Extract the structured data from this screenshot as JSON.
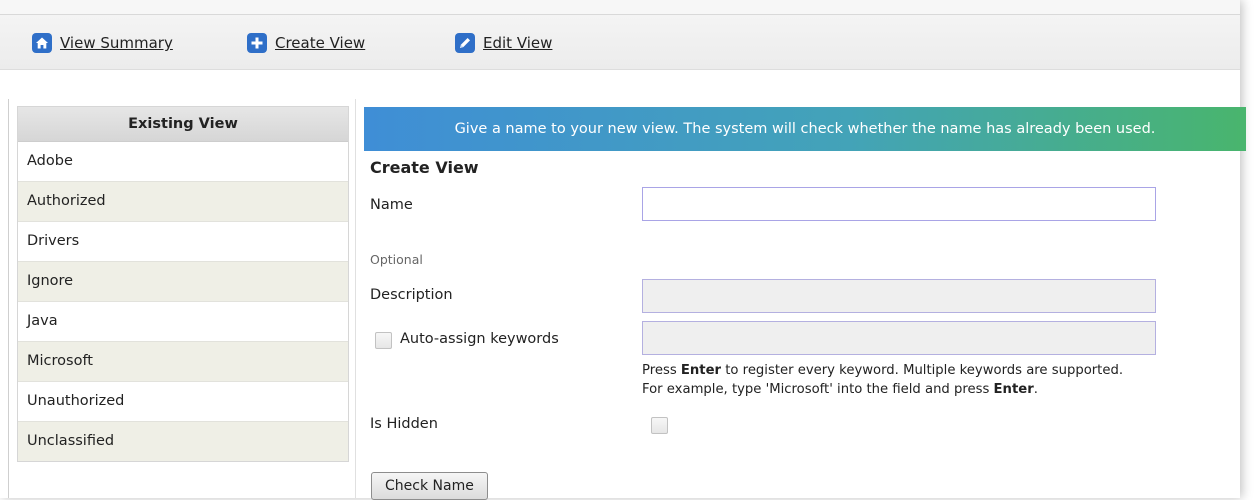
{
  "toolbar": {
    "items": [
      {
        "label": "View Summary",
        "icon": "home-icon"
      },
      {
        "label": "Create View",
        "icon": "plus-icon"
      },
      {
        "label": "Edit View",
        "icon": "pencil-icon"
      }
    ]
  },
  "existing_view": {
    "header": "Existing View",
    "items": [
      "Adobe",
      "Authorized",
      "Drivers",
      "Ignore",
      "Java",
      "Microsoft",
      "Unauthorized",
      "Unclassified"
    ]
  },
  "banner": {
    "text": "Give a name to your new view. The system will check whether the name has already been used."
  },
  "form": {
    "title": "Create View",
    "name_label": "Name",
    "name_value": "",
    "optional_label": "Optional",
    "description_label": "Description",
    "description_value": "",
    "auto_assign_label": "Auto-assign keywords",
    "keywords_value": "",
    "hint_line1_prefix": "Press ",
    "hint_line1_key": "Enter",
    "hint_line1_suffix": " to register every keyword. Multiple keywords are supported.",
    "hint_line2_prefix": "For example, type 'Microsoft' into the field and press ",
    "hint_line2_key": "Enter",
    "hint_line2_suffix": ".",
    "is_hidden_label": "Is Hidden",
    "check_name_button": "Check Name"
  },
  "colors": {
    "icon_blue": "#2f6fc8",
    "banner_start": "#3f8ed6",
    "banner_end": "#49b56d",
    "alt_row": "#efefe6",
    "input_border": "#a9a4e6"
  }
}
